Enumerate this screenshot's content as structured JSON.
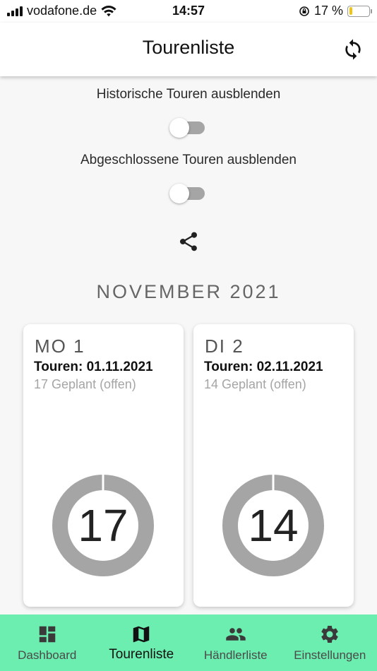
{
  "status_bar": {
    "carrier": "vodafone.de",
    "time": "14:57",
    "battery_percent": "17 %",
    "battery_level": 0.17
  },
  "app_bar": {
    "title": "Tourenliste",
    "refresh_icon": "refresh-icon"
  },
  "filters": {
    "historic": {
      "label": "Historische Touren ausblenden",
      "on": false
    },
    "completed": {
      "label": "Abgeschlossene Touren ausblenden",
      "on": false
    }
  },
  "share_icon": "share-icon",
  "month": "NOVEMBER 2021",
  "days": [
    {
      "day": "MO 1",
      "title": "Touren: 01.11.2021",
      "planned": "17 Geplant (offen)",
      "count": "17",
      "progress": 0.0
    },
    {
      "day": "DI 2",
      "title": "Touren: 02.11.2021",
      "planned": "14 Geplant (offen)",
      "count": "14",
      "progress": 0.0
    }
  ],
  "bottom_nav": {
    "items": [
      {
        "label": "Dashboard",
        "icon": "dashboard-icon",
        "active": false
      },
      {
        "label": "Tourenliste",
        "icon": "map-icon",
        "active": true
      },
      {
        "label": "Händlerliste",
        "icon": "people-icon",
        "active": false
      },
      {
        "label": "Einstellungen",
        "icon": "gear-icon",
        "active": false
      }
    ]
  },
  "colors": {
    "nav_background": "#6ceeb0",
    "donut_ring": "#a5a5a5",
    "battery": "#f2c40f"
  }
}
